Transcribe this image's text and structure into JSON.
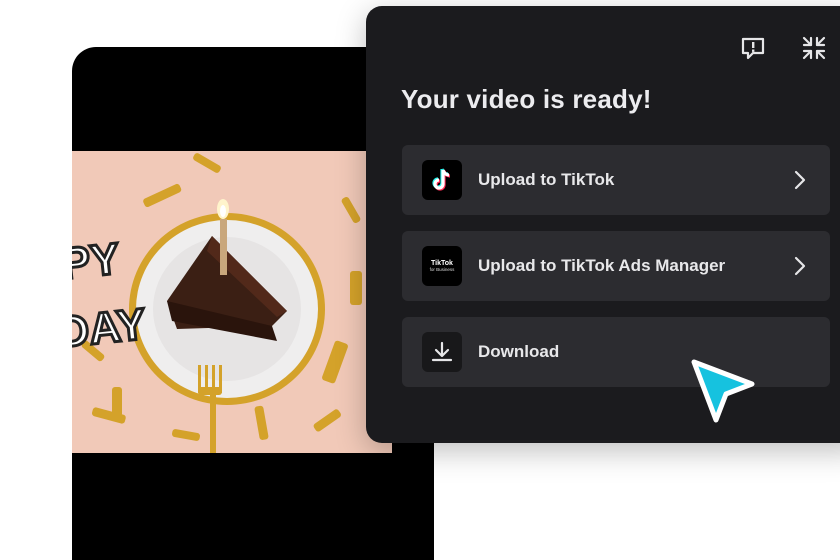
{
  "panel": {
    "title": "Your video is ready!",
    "icons": {
      "feedback": "feedback-icon",
      "collapse": "collapse-icon"
    },
    "options": [
      {
        "label": "Upload to TikTok",
        "icon": "tiktok-logo-icon",
        "has_chevron": true
      },
      {
        "label": "Upload to TikTok Ads Manager",
        "icon": "tiktok-for-business-icon",
        "has_chevron": true
      },
      {
        "label": "Download",
        "icon": "download-icon",
        "has_chevron": false
      }
    ],
    "ads_logo": {
      "wordmark": "TikTok",
      "sub": "for Business"
    }
  },
  "preview": {
    "overlay_text_top": "PY",
    "overlay_text_bottom": "DAY"
  },
  "colors": {
    "panel_bg": "#1b1b1e",
    "row_bg": "#2c2c30",
    "cursor": "#16c2df"
  }
}
